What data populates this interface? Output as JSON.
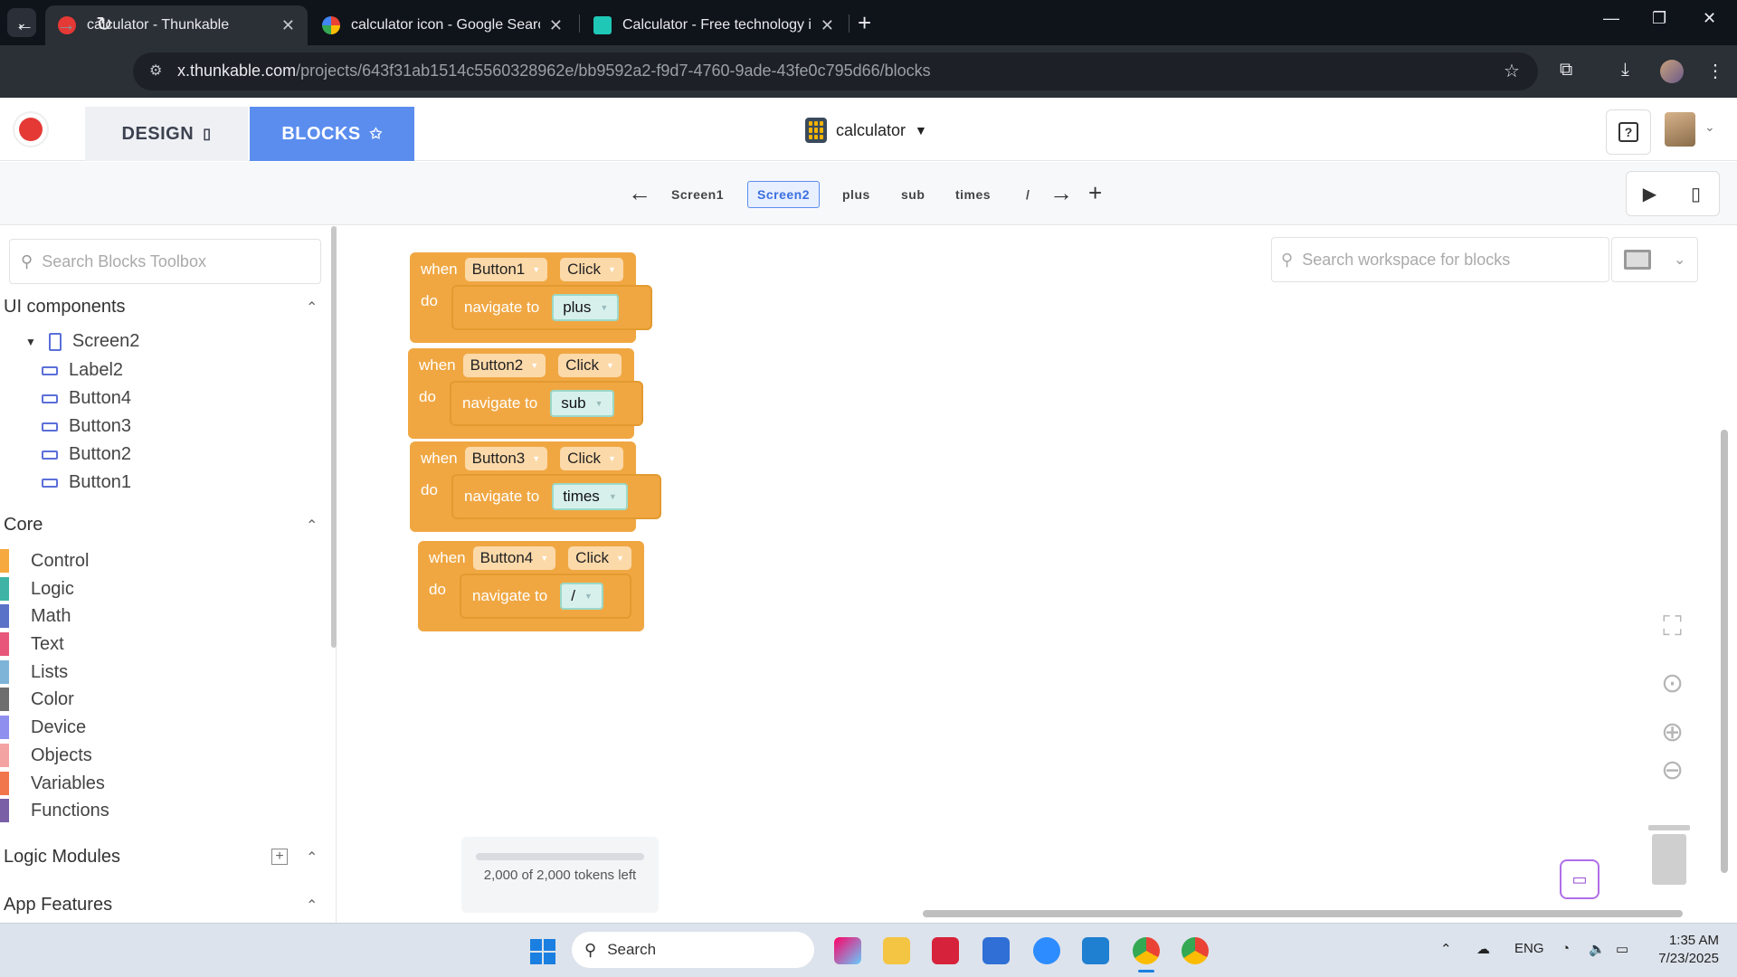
{
  "browser": {
    "tabs": [
      {
        "title": "calculator - Thunkable",
        "active": true
      },
      {
        "title": "calculator icon - Google Search",
        "active": false
      },
      {
        "title": "Calculator - Free technology ic",
        "active": false
      }
    ],
    "url_host": "x.thunkable.com",
    "url_path": "/projects/643f31ab1514c5560328962e/bb9592a2-f9d7-4760-9ade-43fe0c795d66/blocks"
  },
  "app": {
    "design_label": "DESIGN",
    "blocks_label": "BLOCKS",
    "project_name": "calculator",
    "help_label": "?"
  },
  "screens": {
    "items": [
      "Screen1",
      "Screen2",
      "plus",
      "sub",
      "times",
      "/"
    ],
    "active": "Screen2"
  },
  "sidebar": {
    "search_placeholder": "Search Blocks Toolbox",
    "ui_components_label": "UI components",
    "components": [
      "Screen2",
      "Label2",
      "Button4",
      "Button3",
      "Button2",
      "Button1"
    ],
    "core_label": "Core",
    "categories": [
      {
        "name": "Control",
        "color": "#f5a93e"
      },
      {
        "name": "Logic",
        "color": "#3fb4a6"
      },
      {
        "name": "Math",
        "color": "#5b72c9"
      },
      {
        "name": "Text",
        "color": "#e8577a"
      },
      {
        "name": "Lists",
        "color": "#7db4d8"
      },
      {
        "name": "Color",
        "color": "#6e6e6e"
      },
      {
        "name": "Device",
        "color": "#8f8ff0"
      },
      {
        "name": "Objects",
        "color": "#f4a3a3"
      },
      {
        "name": "Variables",
        "color": "#f2764c"
      },
      {
        "name": "Functions",
        "color": "#7a5fa6"
      }
    ],
    "logic_modules_label": "Logic Modules",
    "app_features_label": "App Features"
  },
  "workspace": {
    "search_placeholder": "Search workspace for blocks",
    "blocks": [
      {
        "when": "when",
        "component": "Button1",
        "event": "Click",
        "do": "do",
        "action": "navigate to",
        "target": "plus"
      },
      {
        "when": "when",
        "component": "Button2",
        "event": "Click",
        "do": "do",
        "action": "navigate to",
        "target": "sub"
      },
      {
        "when": "when",
        "component": "Button3",
        "event": "Click",
        "do": "do",
        "action": "navigate to",
        "target": "times"
      },
      {
        "when": "when",
        "component": "Button4",
        "event": "Click",
        "do": "do",
        "action": "navigate to",
        "target": "/"
      }
    ],
    "tokens_text": "2,000 of 2,000 tokens left"
  },
  "taskbar": {
    "search_label": "Search",
    "language": "ENG",
    "time": "1:35 AM",
    "date": "7/23/2025"
  }
}
